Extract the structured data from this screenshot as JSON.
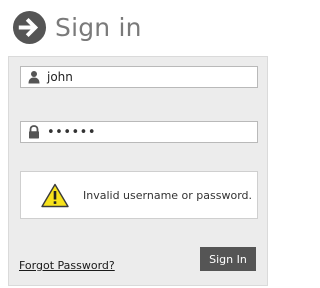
{
  "header": {
    "title": "Sign in",
    "icon": "arrow-right-circle-icon"
  },
  "form": {
    "username": {
      "value": "john",
      "icon": "user-icon"
    },
    "password": {
      "masked_value": "••••••",
      "icon": "lock-icon"
    },
    "error": {
      "message": "Invalid username or password.",
      "icon": "warning-icon"
    },
    "forgot_password_label": "Forgot Password?",
    "submit_label": "Sign In"
  },
  "colors": {
    "header_icon": "#555555",
    "title_text": "#7a7a7a",
    "panel_background": "#ececec",
    "button_background": "#555555",
    "button_text": "#ffffff",
    "warning_fill": "#f7e21b"
  }
}
